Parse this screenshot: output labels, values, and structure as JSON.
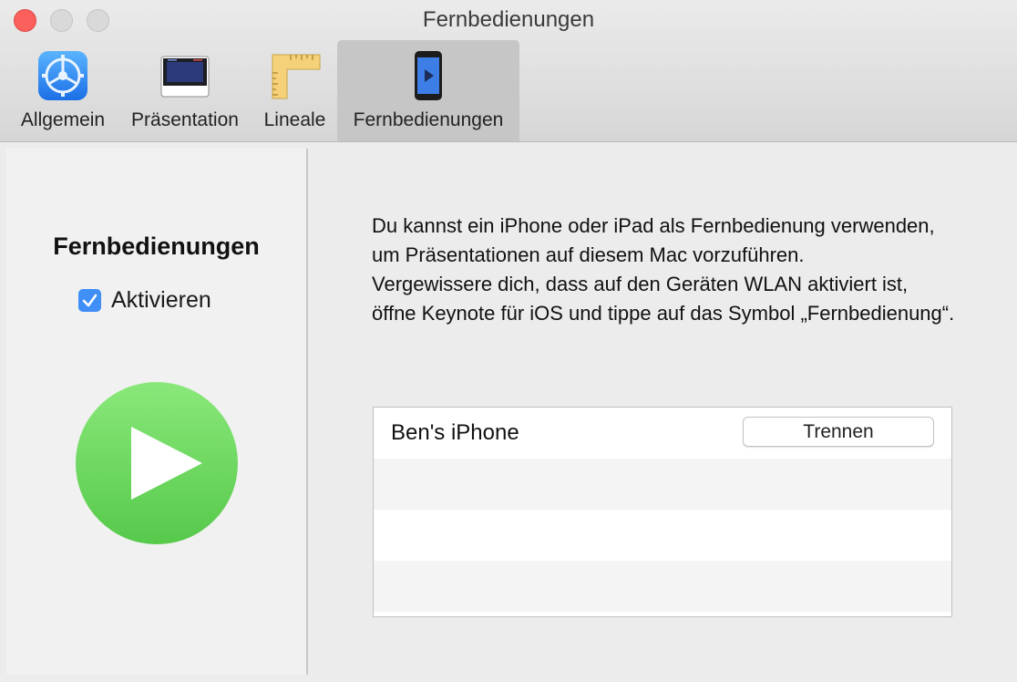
{
  "window": {
    "title": "Fernbedienungen"
  },
  "toolbar": {
    "tabs": [
      {
        "label": "Allgemein",
        "icon": "gear-icon"
      },
      {
        "label": "Präsentation",
        "icon": "presentation-icon"
      },
      {
        "label": "Lineale",
        "icon": "ruler-icon"
      },
      {
        "label": "Fernbedienungen",
        "icon": "remote-phone-icon",
        "active": true
      }
    ]
  },
  "left_pane": {
    "heading": "Fernbedienungen",
    "enable_checkbox": {
      "label": "Aktivieren",
      "checked": true
    },
    "play_icon": "play-icon"
  },
  "right_pane": {
    "description": [
      "Du kannst ein iPhone oder iPad als Fernbedienung verwenden, um Präsentationen auf diesem Mac vorzuführen.",
      "Vergewissere dich, dass auf den Geräten WLAN aktiviert ist, öffne Keynote für iOS und tippe auf das Symbol „Fernbedienung“."
    ],
    "devices": [
      {
        "name": "Ben's iPhone",
        "action_label": "Trennen"
      }
    ]
  },
  "colors": {
    "accent": "#3f8ff7",
    "play_green": "#6cd85f",
    "close_red": "#fc605c"
  }
}
